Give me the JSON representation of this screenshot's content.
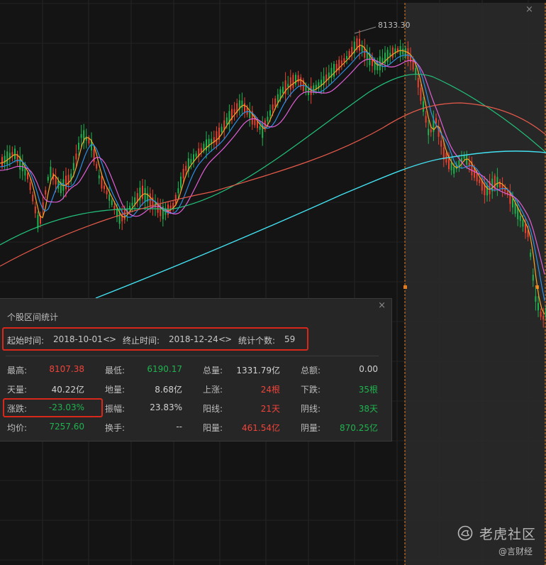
{
  "chart": {
    "high_label": "8133.30",
    "colors": {
      "up": "#e8412f",
      "down": "#1db34f",
      "ma5": "#f5a52a",
      "ma10": "#2e8fe6",
      "ma20": "#e25fd8",
      "ma30": "#22c07a",
      "ma60": "#e65a4a",
      "ma250": "#43e0f0",
      "selection": "#e07b1e"
    }
  },
  "stats_panel": {
    "title": "个股区间统计",
    "start_label": "起始时间:",
    "start_date": "2018-10-01",
    "end_label": "终止时间:",
    "end_date": "2018-12-24",
    "count_label": "统计个数:",
    "count": "59",
    "rows": [
      [
        {
          "label": "最高:",
          "value": "8107.38",
          "color": "red"
        },
        {
          "label": "最低:",
          "value": "6190.17",
          "color": "green"
        },
        {
          "label": "总量:",
          "value": "1331.79亿",
          "color": "white"
        },
        {
          "label": "总额:",
          "value": "0.00",
          "color": "white"
        }
      ],
      [
        {
          "label": "天量:",
          "value": "40.22亿",
          "color": "white"
        },
        {
          "label": "地量:",
          "value": "8.68亿",
          "color": "white"
        },
        {
          "label": "上涨:",
          "value": "24根",
          "color": "red"
        },
        {
          "label": "下跌:",
          "value": "35根",
          "color": "green"
        }
      ],
      [
        {
          "label": "涨跌:",
          "value": "-23.03%",
          "color": "green"
        },
        {
          "label": "振幅:",
          "value": "23.83%",
          "color": "white"
        },
        {
          "label": "阳线:",
          "value": "21天",
          "color": "red"
        },
        {
          "label": "阴线:",
          "value": "38天",
          "color": "green"
        }
      ],
      [
        {
          "label": "均价:",
          "value": "7257.60",
          "color": "green"
        },
        {
          "label": "换手:",
          "value": "--",
          "color": "white"
        },
        {
          "label": "阳量:",
          "value": "461.54亿",
          "color": "red"
        },
        {
          "label": "阴量:",
          "value": "870.25亿",
          "color": "green"
        }
      ]
    ]
  },
  "watermark": {
    "brand": "老虎社区",
    "author": "@言财经"
  },
  "icons": {
    "close": "×",
    "arrows": "<>"
  }
}
